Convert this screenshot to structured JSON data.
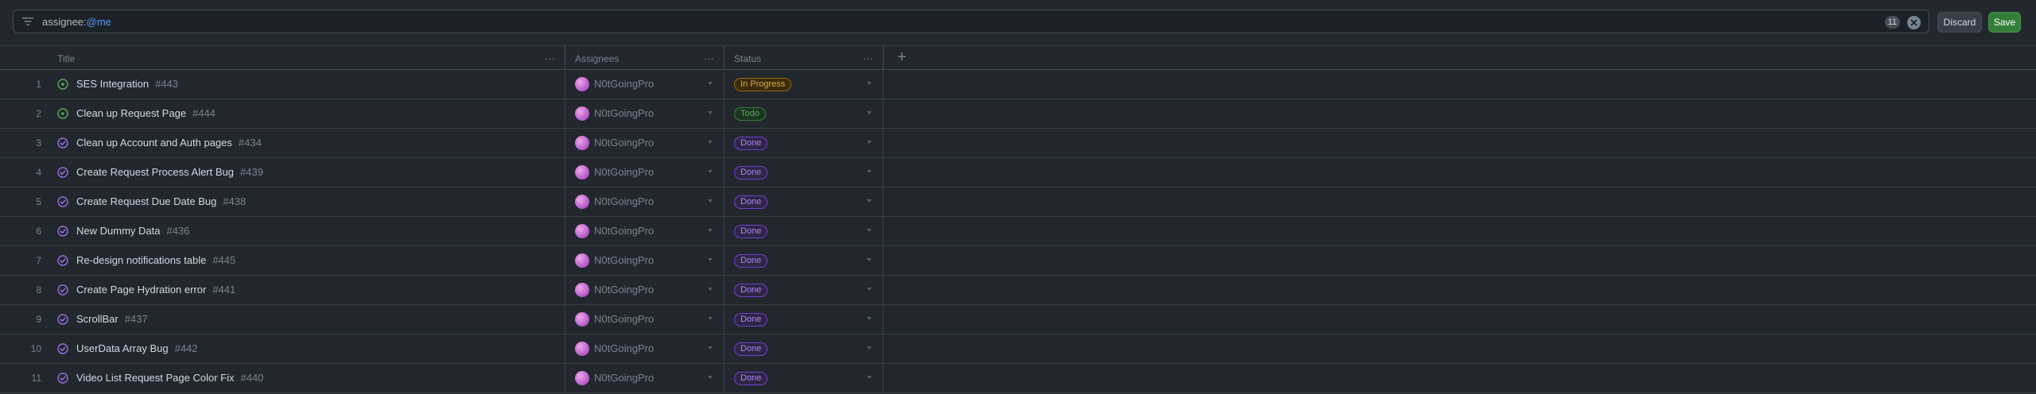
{
  "filter": {
    "key": "assignee:",
    "value": "@me",
    "count": "11",
    "discard_label": "Discard",
    "save_label": "Save"
  },
  "columns": {
    "title": "Title",
    "assignees": "Assignees",
    "status": "Status",
    "menu": "···",
    "add": "+"
  },
  "rows": [
    {
      "num": "1",
      "state": "open",
      "title": "SES Integration",
      "id": "#443",
      "assignee": "N0tGoingPro",
      "status": "In Progress",
      "status_kind": "progress"
    },
    {
      "num": "2",
      "state": "open",
      "title": "Clean up Request Page",
      "id": "#444",
      "assignee": "N0tGoingPro",
      "status": "Todo",
      "status_kind": "todo"
    },
    {
      "num": "3",
      "state": "closed",
      "title": "Clean up Account and Auth pages",
      "id": "#434",
      "assignee": "N0tGoingPro",
      "status": "Done",
      "status_kind": "done"
    },
    {
      "num": "4",
      "state": "closed",
      "title": "Create Request Process Alert Bug",
      "id": "#439",
      "assignee": "N0tGoingPro",
      "status": "Done",
      "status_kind": "done"
    },
    {
      "num": "5",
      "state": "closed",
      "title": "Create Request Due Date Bug",
      "id": "#438",
      "assignee": "N0tGoingPro",
      "status": "Done",
      "status_kind": "done"
    },
    {
      "num": "6",
      "state": "closed",
      "title": "New Dummy Data",
      "id": "#436",
      "assignee": "N0tGoingPro",
      "status": "Done",
      "status_kind": "done"
    },
    {
      "num": "7",
      "state": "closed",
      "title": "Re-design notifications table",
      "id": "#445",
      "assignee": "N0tGoingPro",
      "status": "Done",
      "status_kind": "done"
    },
    {
      "num": "8",
      "state": "closed",
      "title": "Create Page Hydration error",
      "id": "#441",
      "assignee": "N0tGoingPro",
      "status": "Done",
      "status_kind": "done"
    },
    {
      "num": "9",
      "state": "closed",
      "title": "ScrollBar",
      "id": "#437",
      "assignee": "N0tGoingPro",
      "status": "Done",
      "status_kind": "done"
    },
    {
      "num": "10",
      "state": "closed",
      "title": "UserData Array Bug",
      "id": "#442",
      "assignee": "N0tGoingPro",
      "status": "Done",
      "status_kind": "done"
    },
    {
      "num": "11",
      "state": "closed",
      "title": "Video List Request Page Color Fix",
      "id": "#440",
      "assignee": "N0tGoingPro",
      "status": "Done",
      "status_kind": "done"
    }
  ],
  "colors": {
    "open_icon": "#57ab5a",
    "closed_icon": "#986ee2"
  }
}
